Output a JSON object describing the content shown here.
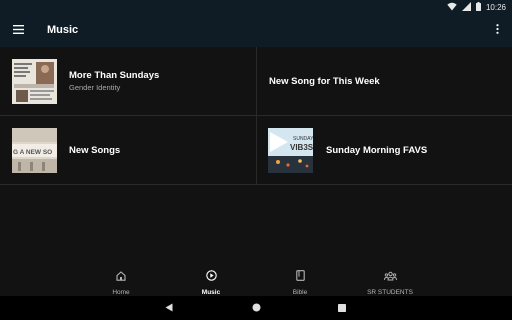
{
  "status_bar": {
    "time": "10:26",
    "icons": [
      "wifi-icon",
      "signal-icon",
      "battery-icon"
    ]
  },
  "app_bar": {
    "title": "Music",
    "menu_icon": "hamburger-menu-icon",
    "overflow_icon": "more-vert-icon"
  },
  "content": {
    "items": [
      {
        "title": "More Than Sundays",
        "subtitle": "Gender Identity",
        "thumbnail": "more-than-sundays-artwork"
      },
      {
        "title": "New Song for This Week",
        "subtitle": "",
        "thumbnail": ""
      },
      {
        "title": "New Songs",
        "subtitle": "",
        "thumbnail": "new-songs-artwork"
      },
      {
        "title": "Sunday Morning FAVS",
        "subtitle": "",
        "thumbnail": "sunday-vibes-artwork"
      }
    ]
  },
  "bottom_nav": {
    "active": "Music",
    "items": [
      {
        "label": "Home",
        "icon": "home-icon"
      },
      {
        "label": "Music",
        "icon": "play-circle-icon"
      },
      {
        "label": "Bible",
        "icon": "book-icon"
      },
      {
        "label": "SR STUDENTS",
        "icon": "group-icon"
      }
    ]
  },
  "system_nav": {
    "icons": [
      "back-icon",
      "home-circle-icon",
      "recents-icon"
    ]
  },
  "colors": {
    "app_bar_bg": "#0f1c25",
    "body_bg": "#121212",
    "divider": "#2a2a2a",
    "secondary_text": "#a9a9a9",
    "nav_text": "#b5b5b5"
  }
}
